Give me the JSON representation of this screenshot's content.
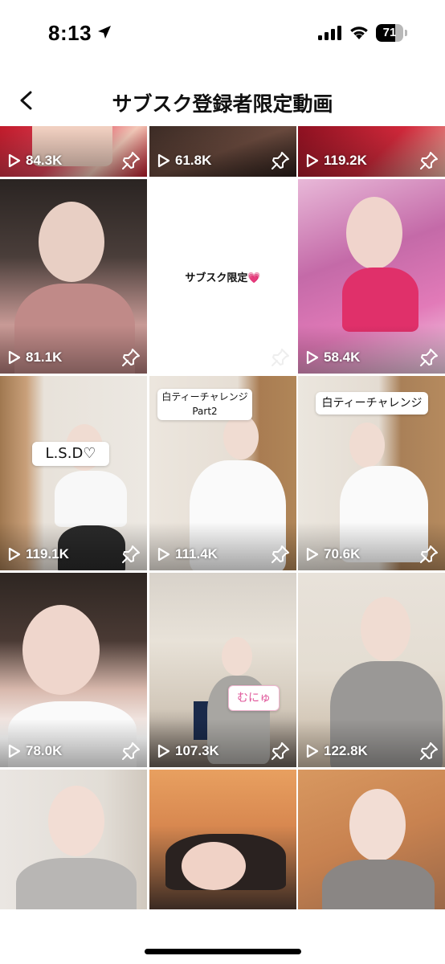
{
  "status_bar": {
    "time": "8:13",
    "battery_level": "71",
    "battery_fraction": 0.71
  },
  "header": {
    "title": "サブスク登録者限定動画",
    "back_icon": "chevron-left-icon"
  },
  "videos": [
    {
      "views": "84.3K",
      "caption": ""
    },
    {
      "views": "61.8K",
      "caption": ""
    },
    {
      "views": "119.2K",
      "caption": ""
    },
    {
      "views": "81.1K",
      "caption": ""
    },
    {
      "views": "",
      "caption": "サブスク限定💗"
    },
    {
      "views": "58.4K",
      "caption": ""
    },
    {
      "views": "119.1K",
      "caption": "L.S.D♡"
    },
    {
      "views": "111.4K",
      "caption": "白ティーチャレンジ\nPart2"
    },
    {
      "views": "70.6K",
      "caption": "白ティーチャレンジ"
    },
    {
      "views": "78.0K",
      "caption": ""
    },
    {
      "views": "107.3K",
      "caption": "むにゅ"
    },
    {
      "views": "122.8K",
      "caption": ""
    },
    {
      "views": "",
      "caption": ""
    },
    {
      "views": "",
      "caption": ""
    },
    {
      "views": "",
      "caption": ""
    }
  ],
  "colors": {
    "caption_pink": "#e0569a",
    "text": "#111111",
    "background": "#ffffff"
  }
}
